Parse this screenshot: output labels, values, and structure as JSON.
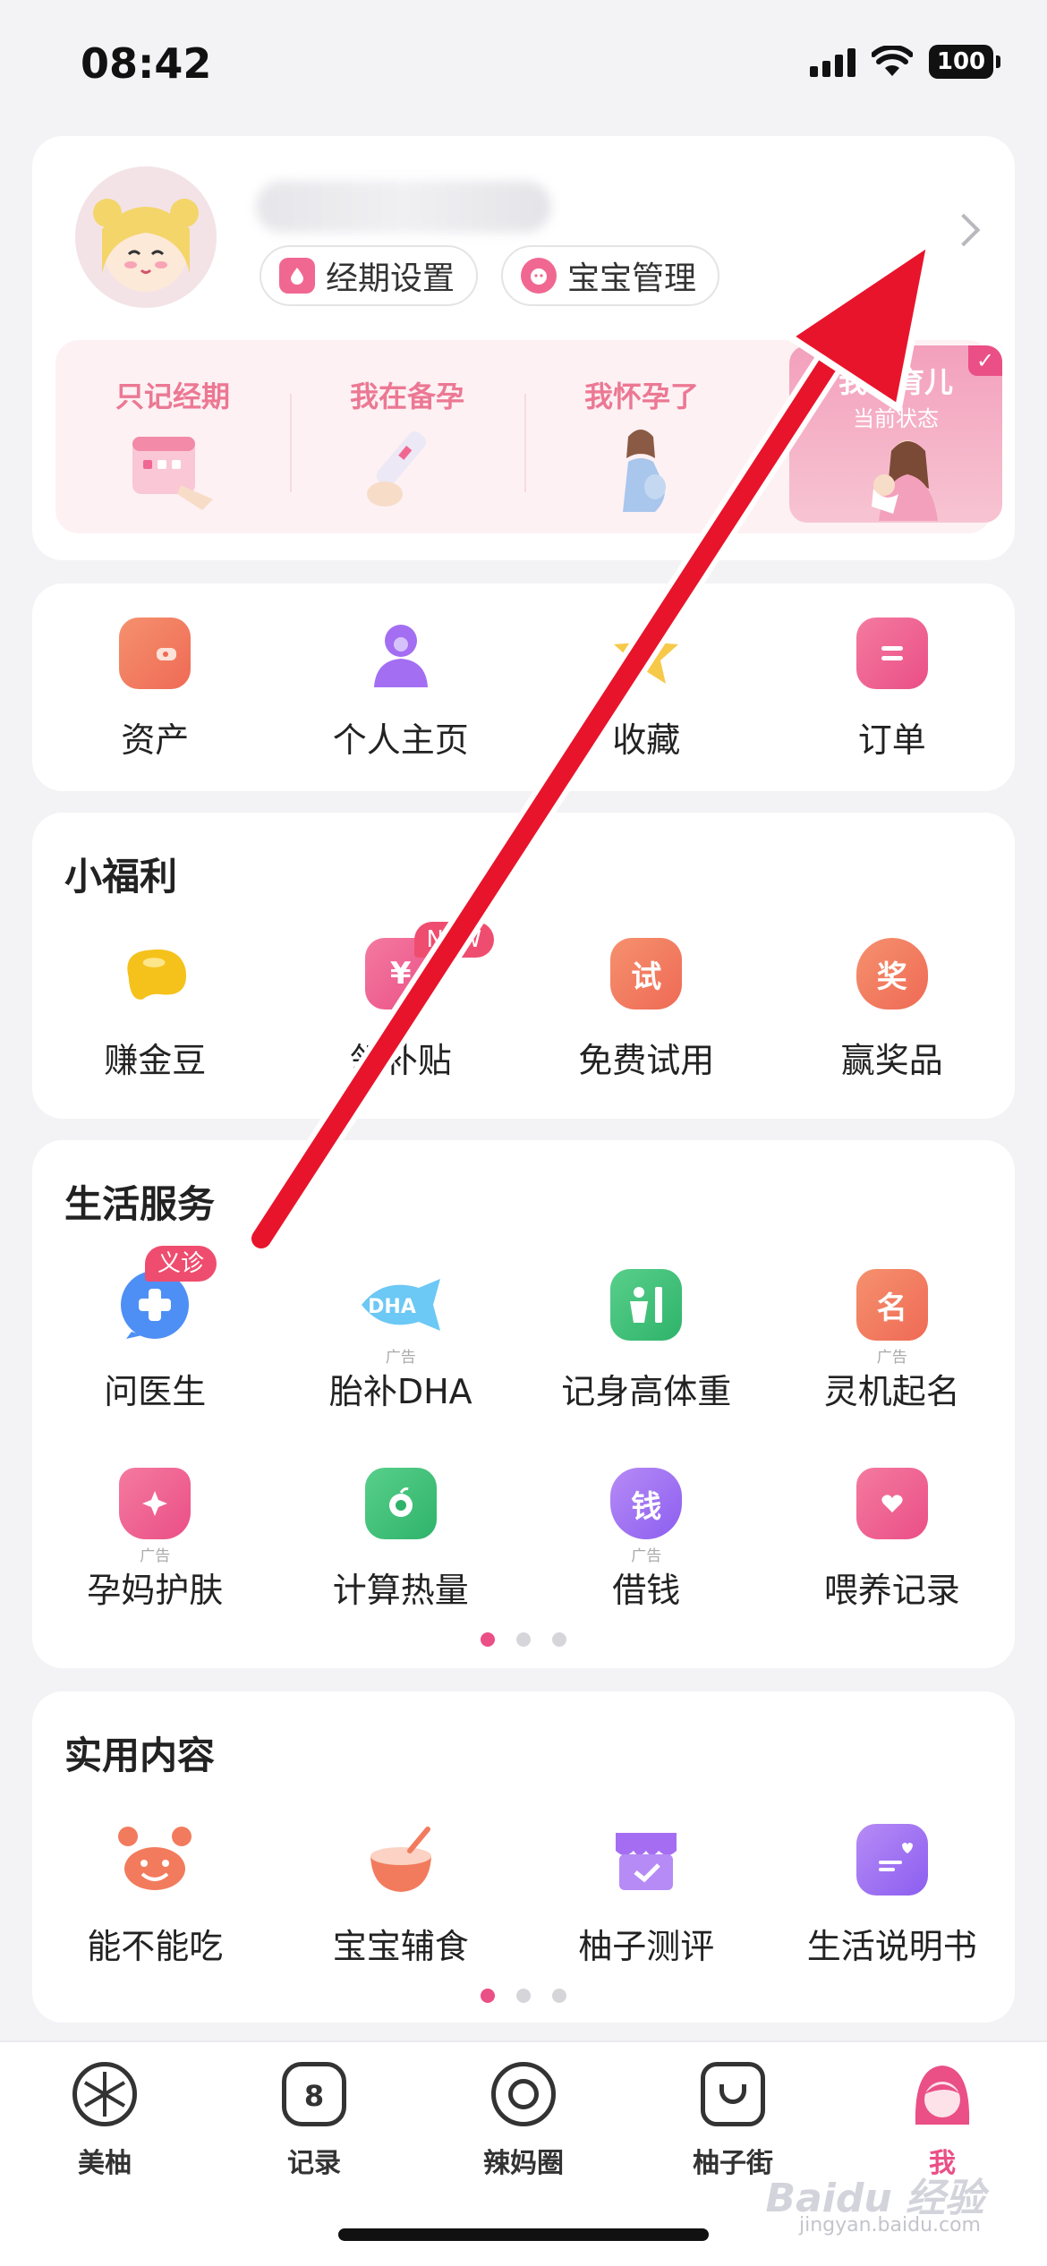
{
  "status_bar": {
    "time": "08:42",
    "battery": "100"
  },
  "profile": {
    "chips": [
      "经期设置",
      "宝宝管理"
    ],
    "stages": [
      "只记经期",
      "我在备孕",
      "我怀孕了"
    ],
    "active_stage": {
      "label": "我在育儿",
      "sub": "当前状态"
    }
  },
  "quick": [
    {
      "label": "资产"
    },
    {
      "label": "个人主页"
    },
    {
      "label": "收藏"
    },
    {
      "label": "订单"
    }
  ],
  "welfare": {
    "title": "小福利",
    "items": [
      {
        "label": "赚金豆",
        "glyph": ""
      },
      {
        "label": "领补贴",
        "glyph": "¥",
        "badge": "NEW"
      },
      {
        "label": "免费试用",
        "glyph": "试"
      },
      {
        "label": "赢奖品",
        "glyph": "奖"
      }
    ]
  },
  "services": {
    "title": "生活服务",
    "row1": [
      {
        "label": "问医生",
        "badge": "义诊",
        "ad": ""
      },
      {
        "label": "胎补DHA",
        "glyph": "DHA",
        "ad": "广告"
      },
      {
        "label": "记身高体重",
        "ad": ""
      },
      {
        "label": "灵机起名",
        "glyph": "名",
        "ad": "广告"
      }
    ],
    "row2": [
      {
        "label": "孕妈护肤",
        "ad": "广告"
      },
      {
        "label": "计算热量",
        "ad": ""
      },
      {
        "label": "借钱",
        "glyph": "钱",
        "ad": "广告"
      },
      {
        "label": "喂养记录",
        "ad": ""
      }
    ]
  },
  "content": {
    "title": "实用内容",
    "items": [
      {
        "label": "能不能吃"
      },
      {
        "label": "宝宝辅食"
      },
      {
        "label": "柚子测评"
      },
      {
        "label": "生活说明书"
      }
    ]
  },
  "tabs": [
    {
      "label": "美柚",
      "icon": "lemon-icon"
    },
    {
      "label": "记录",
      "icon": "calendar-icon",
      "glyph": "8"
    },
    {
      "label": "辣妈圈",
      "icon": "lollipop-icon"
    },
    {
      "label": "柚子街",
      "icon": "shopping-bag-icon"
    },
    {
      "label": "我",
      "icon": "me-avatar-icon",
      "active": true
    }
  ],
  "colors": {
    "accent": "#ea4f86",
    "arrow": "#e8142b"
  },
  "watermark": {
    "brand": "Baidu 经验",
    "url": "jingyan.baidu.com"
  }
}
